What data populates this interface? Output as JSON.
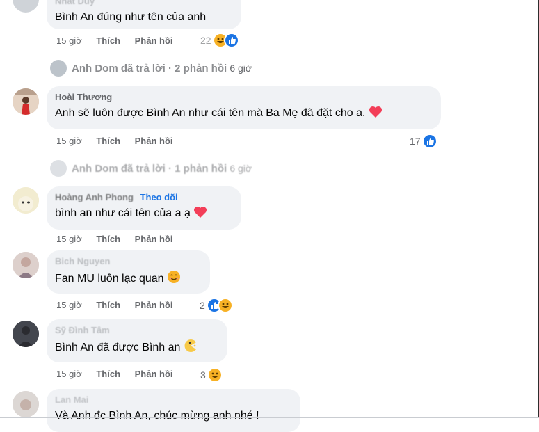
{
  "comments": [
    {
      "author": "Nhat Duy",
      "text": "Bình An đúng như tên của anh",
      "time": "15 giờ",
      "like": "Thích",
      "reply": "Phản hồi",
      "reaction_count": "22",
      "reactions": [
        "haha-icon",
        "like-icon"
      ]
    },
    {
      "author": "Hoài Thương",
      "text": "Anh sẽ luôn được Bình An như cái tên mà Ba Mẹ đã đặt cho a.",
      "emoji": "heart-icon",
      "time": "15 giờ",
      "like": "Thích",
      "reply": "Phản hồi",
      "reaction_count": "17",
      "reactions": [
        "like-icon"
      ]
    },
    {
      "author": "Hoàng Anh Phong",
      "follow": "Theo dõi",
      "text": "bình an như cái tên của a ạ",
      "emoji": "heart-icon",
      "time": "15 giờ",
      "like": "Thích",
      "reply": "Phản hồi"
    },
    {
      "author": "Bich Nguyen",
      "text": "Fan MU luôn lạc quan",
      "emoji": "smile-icon",
      "time": "15 giờ",
      "like": "Thích",
      "reply": "Phản hồi",
      "reaction_count": "2",
      "reactions": [
        "like-icon",
        "haha-icon"
      ]
    },
    {
      "author": "Sỹ Đình Tâm",
      "text": "Bình An đã được Bình an",
      "emoji": "pacman-icon",
      "time": "15 giờ",
      "like": "Thích",
      "reply": "Phản hồi",
      "reaction_count": "3",
      "reactions": [
        "haha-icon"
      ]
    },
    {
      "author": "Lan Mai",
      "text": "Và Anh đc Bình An, chúc mừng anh nhé !"
    }
  ],
  "reply_threads": [
    {
      "author": "Anh Dom",
      "label": "Anh Dom đã trả lời · 2 phản hồi",
      "ago": "6 giờ"
    },
    {
      "author": "Anh Dom",
      "label": "Anh Dom đã trả lời · 1 phản hồi",
      "ago": "6 giờ"
    }
  ],
  "colors": {
    "bubble": "#f0f2f5",
    "meta": "#65676b",
    "like_blue": "#1b74e4",
    "haha_yellow": "#f7b125",
    "heart_red": "#f33e58"
  }
}
